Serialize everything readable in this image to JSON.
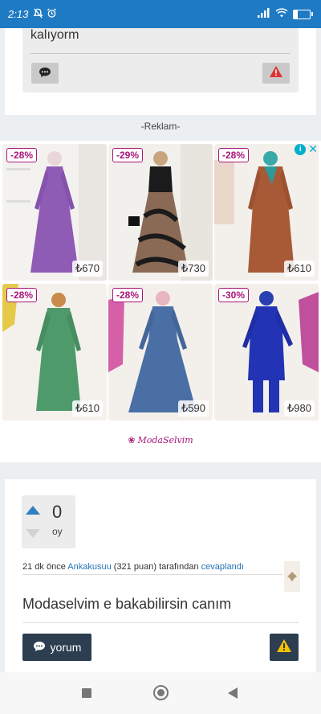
{
  "status_bar": {
    "time": "2:13",
    "battery": "27",
    "battery_level": 0.27
  },
  "previous_answer": {
    "text": "kalıyorm"
  },
  "ad": {
    "label": "-Reklam-",
    "brand": "ModaSelvim",
    "products": [
      {
        "discount": "-28%",
        "price": "₺670"
      },
      {
        "discount": "-29%",
        "price": "₺730"
      },
      {
        "discount": "-28%",
        "price": "₺610"
      },
      {
        "discount": "-28%",
        "price": "₺610"
      },
      {
        "discount": "-28%",
        "price": "₺590"
      },
      {
        "discount": "-30%",
        "price": "₺980"
      }
    ]
  },
  "answer": {
    "votes": "0",
    "votes_unit": "oy",
    "meta": {
      "time": "21 dk önce",
      "user": "Ankakusuu",
      "points": "(321 puan)",
      "by": "tarafından",
      "action": "cevaplandı"
    },
    "text": "Modaselvim e bakabilirsin canım",
    "comment_button": "yorum"
  },
  "icons": {
    "comment": "comment-icon",
    "warning": "warning-icon",
    "vote_up": "arrow-up-icon",
    "vote_down": "arrow-down-icon"
  },
  "colors": {
    "status_bar": "#1f7ac4",
    "discount_badge": "#a8157a",
    "dark_button": "#2c3e50",
    "link": "#2573b6",
    "vote_up": "#2f80c2"
  }
}
